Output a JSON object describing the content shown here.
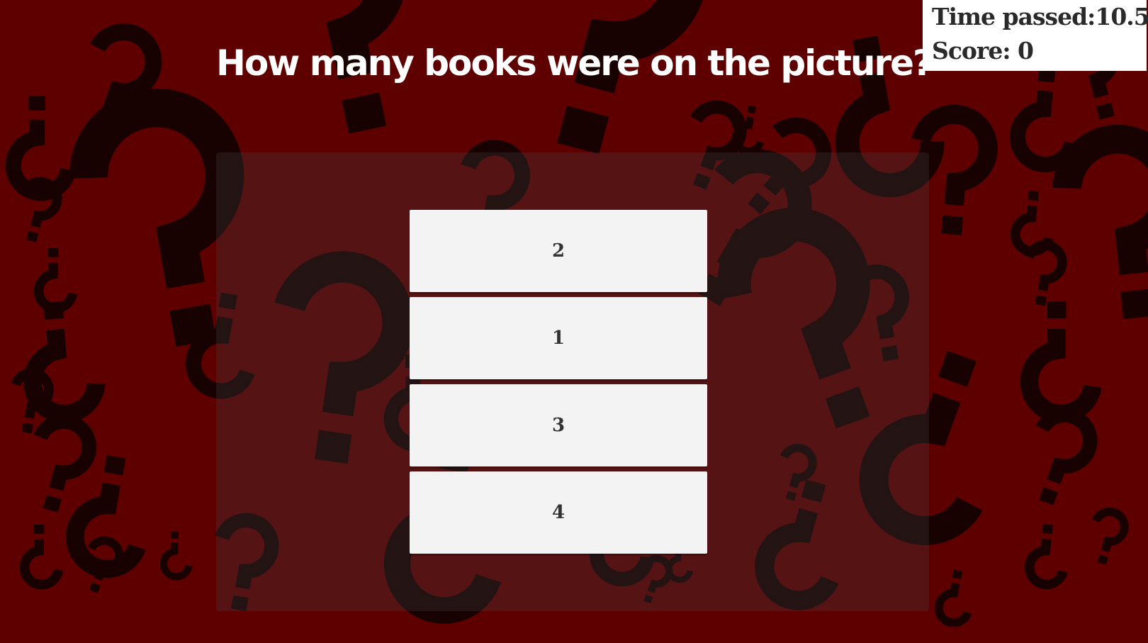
{
  "question": "How many books were on the picture?",
  "hud": {
    "time_label": "Time passed:",
    "time_value": "10.5",
    "score_label": "Score: ",
    "score_value": "0"
  },
  "answers": [
    "2",
    "1",
    "3",
    "4"
  ],
  "colors": {
    "background": "#5e0000",
    "pattern": "#150202",
    "button": "#f3f3f3",
    "button_text": "#333333",
    "hud_background": "#ffffff"
  }
}
